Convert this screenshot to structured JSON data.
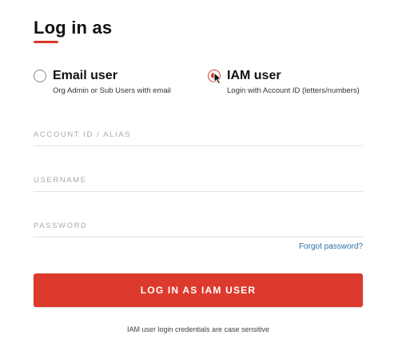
{
  "title": "Log in as",
  "accent_color": "#d9382b",
  "options": {
    "email": {
      "label": "Email user",
      "description": "Org Admin or Sub Users with email",
      "selected": false
    },
    "iam": {
      "label": "IAM user",
      "description": "Login with Account ID (letters/numbers)",
      "selected": true
    }
  },
  "fields": {
    "account_id": {
      "placeholder": "ACCOUNT ID / ALIAS",
      "value": ""
    },
    "username": {
      "placeholder": "USERNAME",
      "value": ""
    },
    "password": {
      "placeholder": "PASSWORD",
      "value": ""
    }
  },
  "forgot_password": "Forgot password?",
  "login_button": "LOG IN AS IAM USER",
  "note": "IAM user login credentials are case sensitive",
  "icons": [
    "radio-unselected-icon",
    "radio-selected-icon",
    "mouse-pointer-icon"
  ]
}
